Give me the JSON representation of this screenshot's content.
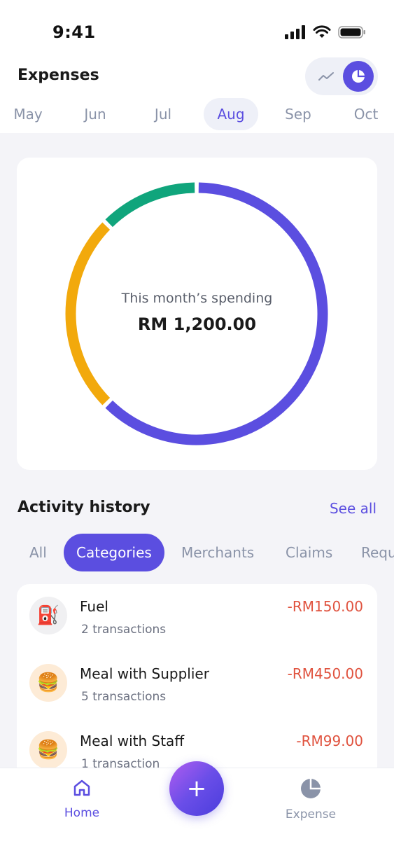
{
  "status_bar": {
    "time": "9:41"
  },
  "header": {
    "title": "Expenses",
    "view_icons": [
      "line-chart-icon",
      "pie-chart-icon"
    ]
  },
  "months": [
    {
      "label": "May",
      "active": false
    },
    {
      "label": "Jun",
      "active": false
    },
    {
      "label": "Jul",
      "active": false
    },
    {
      "label": "Aug",
      "active": true
    },
    {
      "label": "Sep",
      "active": false
    },
    {
      "label": "Oct",
      "active": false
    }
  ],
  "chart": {
    "label": "This month’s spending",
    "amount": "RM 1,200.00"
  },
  "chart_data": {
    "type": "pie",
    "variant": "donut",
    "segments": [
      {
        "value": 0.625,
        "color": "#5b4ee0"
      },
      {
        "value": 0.25,
        "color": "#f2a90c"
      },
      {
        "value": 0.125,
        "color": "#10a57c"
      }
    ]
  },
  "activity": {
    "title": "Activity history",
    "see_all": "See all",
    "tabs": [
      {
        "label": "All",
        "active": false
      },
      {
        "label": "Categories",
        "active": true
      },
      {
        "label": "Merchants",
        "active": false
      },
      {
        "label": "Claims",
        "active": false
      },
      {
        "label": "Requ",
        "active": false
      }
    ],
    "items": [
      {
        "icon": "fuel-pump-icon",
        "glyph": "⛽",
        "bg": "#f0f0f2",
        "name": "Fuel",
        "sub": "2 transactions",
        "amount": "-RM150.00"
      },
      {
        "icon": "burger-icon",
        "glyph": "🍔",
        "bg": "#fdebd6",
        "name": "Meal with Supplier",
        "sub": "5 transactions",
        "amount": "-RM450.00"
      },
      {
        "icon": "burger-icon",
        "glyph": "🍔",
        "bg": "#fdebd6",
        "name": "Meal with Staff",
        "sub": "1 transaction",
        "amount": "-RM99.00"
      }
    ]
  },
  "nav": {
    "home_label": "Home",
    "expense_label": "Expense",
    "active_color": "#5b4ee0",
    "inactive_color": "#8a93a8"
  }
}
